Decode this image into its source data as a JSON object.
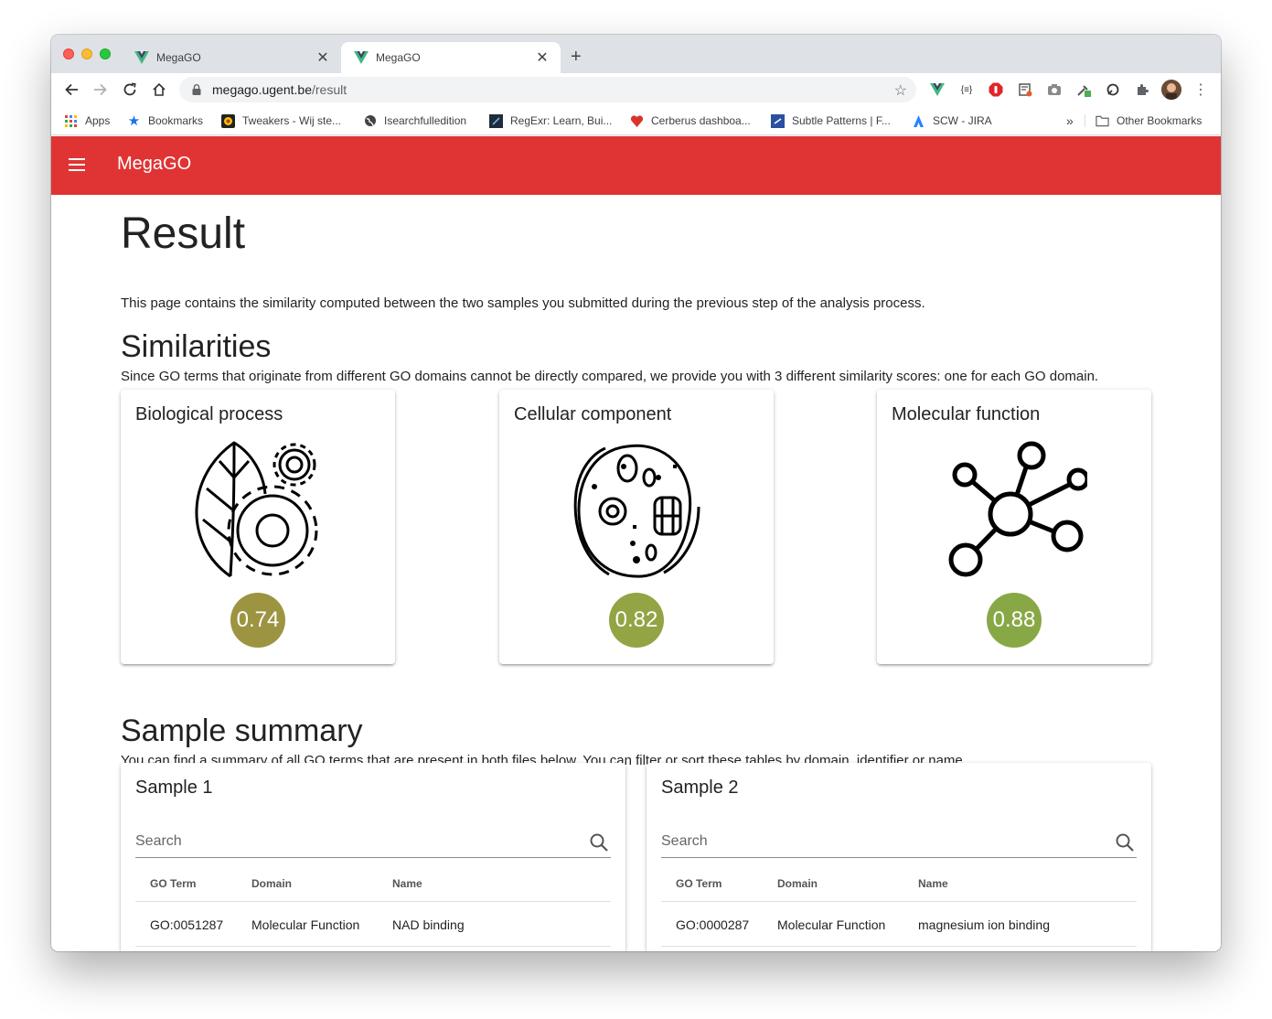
{
  "browser": {
    "tabs": [
      {
        "title": "MegaGO",
        "active": false
      },
      {
        "title": "MegaGO",
        "active": true
      }
    ],
    "url_host": "megago.ugent.be",
    "url_path": "/result",
    "bookmarks": [
      "Apps",
      "Bookmarks",
      "Tweakers - Wij ste...",
      "Isearchfulledition",
      "RegExr: Learn, Bui...",
      "Cerberus dashboa...",
      "Subtle Patterns | F...",
      "SCW - JIRA"
    ],
    "overflow_label": "»",
    "other_bookmarks": "Other Bookmarks"
  },
  "appbar": {
    "title": "MegaGO",
    "color": "#e03434"
  },
  "page": {
    "title": "Result",
    "intro": "This page contains the similarity computed between the two samples you submitted during the previous step of the analysis process.",
    "similarities_heading": "Similarities",
    "similarities_text": "Since GO terms that originate from different GO domains cannot be directly compared, we provide you with 3 different similarity scores: one for each GO domain.",
    "summary_heading": "Sample summary",
    "summary_text": "You can find a summary of all GO terms that are present in both files below. You can filter or sort these tables by domain, identifier or name."
  },
  "similarity_cards": [
    {
      "title": "Biological process",
      "score": "0.74",
      "icon": "leaf-gears-icon",
      "color": "#9c9440"
    },
    {
      "title": "Cellular component",
      "score": "0.82",
      "icon": "cell-icon",
      "color": "#92a444"
    },
    {
      "title": "Molecular function",
      "score": "0.88",
      "icon": "molecule-icon",
      "color": "#88a846"
    }
  ],
  "samples": [
    {
      "title": "Sample 1",
      "search_placeholder": "Search",
      "columns": [
        "GO Term",
        "Domain",
        "Name"
      ],
      "rows": [
        {
          "term": "GO:0051287",
          "domain": "Molecular Function",
          "name": "NAD binding"
        }
      ]
    },
    {
      "title": "Sample 2",
      "search_placeholder": "Search",
      "columns": [
        "GO Term",
        "Domain",
        "Name"
      ],
      "rows": [
        {
          "term": "GO:0000287",
          "domain": "Molecular Function",
          "name": "magnesium ion binding"
        }
      ]
    }
  ]
}
